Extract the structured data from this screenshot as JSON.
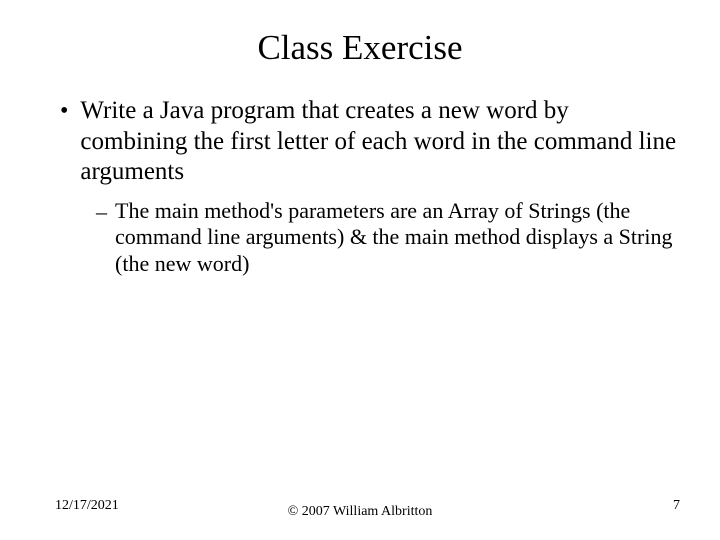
{
  "title": "Class Exercise",
  "bullet": {
    "marker": "•",
    "text": "Write a Java program that creates a new word by combining the first letter of each word in the command line arguments"
  },
  "subbullet": {
    "marker": "–",
    "text": "The main method's parameters are an Array of Strings (the command line arguments) & the main method displays a String (the new word)"
  },
  "footer": {
    "date": "12/17/2021",
    "copyright": "© 2007 William Albritton",
    "page": "7"
  }
}
